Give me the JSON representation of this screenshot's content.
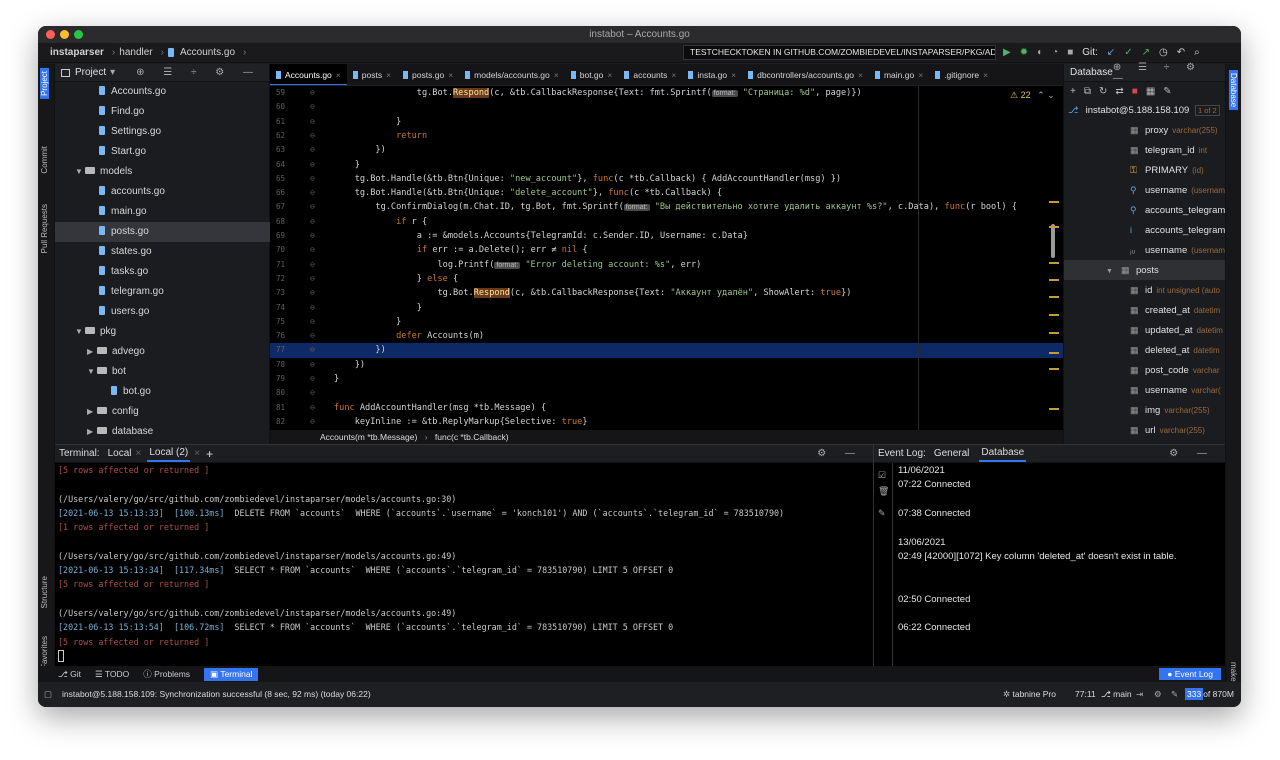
{
  "window": {
    "title": "instabot – Accounts.go"
  },
  "navbar": {
    "crumbs": [
      "instaparser",
      "handler",
      "Accounts.go"
    ],
    "run_config": "TESTCHECKTOKEN IN GITHUB.COM/ZOMBIEDEVEL/INSTAPARSER/PKG/ADVEGO",
    "git_label": "Git:"
  },
  "project": {
    "title": "Project",
    "items": [
      {
        "label": "Accounts.go",
        "type": "file",
        "indent": 3
      },
      {
        "label": "Find.go",
        "type": "file",
        "indent": 3
      },
      {
        "label": "Settings.go",
        "type": "file",
        "indent": 3
      },
      {
        "label": "Start.go",
        "type": "file",
        "indent": 3
      },
      {
        "label": "models",
        "type": "folder-open",
        "indent": 1
      },
      {
        "label": "accounts.go",
        "type": "file",
        "indent": 3
      },
      {
        "label": "main.go",
        "type": "file",
        "indent": 3
      },
      {
        "label": "posts.go",
        "type": "file",
        "indent": 3,
        "selected": true
      },
      {
        "label": "states.go",
        "type": "file",
        "indent": 3
      },
      {
        "label": "tasks.go",
        "type": "file",
        "indent": 3
      },
      {
        "label": "telegram.go",
        "type": "file",
        "indent": 3
      },
      {
        "label": "users.go",
        "type": "file",
        "indent": 3
      },
      {
        "label": "pkg",
        "type": "folder-open",
        "indent": 1
      },
      {
        "label": "advego",
        "type": "folder",
        "indent": 2
      },
      {
        "label": "bot",
        "type": "folder-open",
        "indent": 2
      },
      {
        "label": "bot.go",
        "type": "file",
        "indent": 4
      },
      {
        "label": "config",
        "type": "folder",
        "indent": 2
      },
      {
        "label": "database",
        "type": "folder",
        "indent": 2
      }
    ]
  },
  "editor": {
    "tabs": [
      {
        "label": "Accounts.go",
        "active": true
      },
      {
        "label": "posts"
      },
      {
        "label": "posts.go"
      },
      {
        "label": "models/accounts.go"
      },
      {
        "label": "bot.go"
      },
      {
        "label": "accounts"
      },
      {
        "label": "insta.go"
      },
      {
        "label": "dbcontrollers/accounts.go"
      },
      {
        "label": "main.go"
      },
      {
        "label": ".gitignore"
      }
    ],
    "warnings": "22",
    "current_line": "77",
    "lines": [
      {
        "n": "59",
        "code": "                tg.Bot.Respond(c, &tb.CallbackResponse{Text: fmt.Sprintf(format: \"Страница: %d\", page)})"
      },
      {
        "n": "60",
        "code": ""
      },
      {
        "n": "61",
        "code": "            }"
      },
      {
        "n": "62",
        "code": "            return"
      },
      {
        "n": "63",
        "code": "        })"
      },
      {
        "n": "64",
        "code": "    }"
      },
      {
        "n": "65",
        "code": "    tg.Bot.Handle(&tb.Btn{Unique: \"new_account\"}, func(c *tb.Callback) { AddAccountHandler(msg) })"
      },
      {
        "n": "66",
        "code": "    tg.Bot.Handle(&tb.Btn{Unique: \"delete_account\"}, func(c *tb.Callback) {"
      },
      {
        "n": "67",
        "code": "        tg.ConfirmDialog(m.Chat.ID, tg.Bot, fmt.Sprintf(format: \"Вы действительно хотите удалить аккаунт %s?\", c.Data), func(r bool) {"
      },
      {
        "n": "68",
        "code": "            if r {"
      },
      {
        "n": "69",
        "code": "                a := &models.Accounts{TelegramId: c.Sender.ID, Username: c.Data}"
      },
      {
        "n": "70",
        "code": "                if err := a.Delete(); err ≠ nil {"
      },
      {
        "n": "71",
        "code": "                    log.Printf(format: \"Error deleting account: %s\", err)"
      },
      {
        "n": "72",
        "code": "                } else {"
      },
      {
        "n": "73",
        "code": "                    tg.Bot.Respond(c, &tb.CallbackResponse{Text: \"Аккаунт удалён\", ShowAlert: true})"
      },
      {
        "n": "74",
        "code": "                }"
      },
      {
        "n": "75",
        "code": "            }"
      },
      {
        "n": "76",
        "code": "            defer Accounts(m)"
      },
      {
        "n": "77",
        "code": "        })"
      },
      {
        "n": "78",
        "code": "    })"
      },
      {
        "n": "79",
        "code": "}"
      },
      {
        "n": "80",
        "code": ""
      },
      {
        "n": "81",
        "code": "func AddAccountHandler(msg *tb.Message) {"
      },
      {
        "n": "82",
        "code": "    keyInline := &tb.ReplyMarkup{Selective: true}"
      }
    ],
    "footer_crumbs": [
      "Accounts(m *tb.Message)",
      "func(c *tb.Callback)"
    ]
  },
  "database": {
    "title": "Database",
    "connection": "instabot@5.188.158.109",
    "connection_badge": "1 of 2",
    "rows": [
      {
        "label": "proxy",
        "sub": "varchar(255)",
        "icon": "column"
      },
      {
        "label": "telegram_id",
        "sub": "int",
        "icon": "column-key"
      },
      {
        "label": "PRIMARY",
        "sub": "(id)",
        "icon": "key"
      },
      {
        "label": "username",
        "sub": "(usernam",
        "icon": "index"
      },
      {
        "label": "accounts_telegram",
        "sub": "",
        "icon": "fk"
      },
      {
        "label": "accounts_telegram",
        "sub": "",
        "icon": "index-i"
      },
      {
        "label": "username",
        "sub": "(usernam",
        "icon": "index-u"
      },
      {
        "label": "posts",
        "sub": "",
        "icon": "table",
        "selected": true
      },
      {
        "label": "id",
        "sub": "int unsigned (auto",
        "icon": "column-key"
      },
      {
        "label": "created_at",
        "sub": "datetim",
        "icon": "column"
      },
      {
        "label": "updated_at",
        "sub": "datetim",
        "icon": "column"
      },
      {
        "label": "deleted_at",
        "sub": "datetim",
        "icon": "column"
      },
      {
        "label": "post_code",
        "sub": "varchar",
        "icon": "column"
      },
      {
        "label": "username",
        "sub": "varchar(",
        "icon": "column"
      },
      {
        "label": "img",
        "sub": "varchar(255)",
        "icon": "column"
      },
      {
        "label": "url",
        "sub": "varchar(255)",
        "icon": "column"
      }
    ]
  },
  "terminal": {
    "label": "Terminal:",
    "tabs": [
      "Local",
      "Local (2)"
    ],
    "lines": [
      {
        "kind": "red",
        "text": "[5 rows affected or returned ]"
      },
      {
        "kind": "blank",
        "text": ""
      },
      {
        "kind": "path",
        "text": "(/Users/valery/go/src/github.com/zombiedevel/instaparser/models/accounts.go:30)"
      },
      {
        "kind": "sql",
        "ts": "[2021-06-13 15:13:33]",
        "ms": "[100.13ms]",
        "text": "DELETE FROM `accounts`  WHERE (`accounts`.`username` = 'konch101') AND (`accounts`.`telegram_id` = 783510790)"
      },
      {
        "kind": "red",
        "text": "[1 rows affected or returned ]"
      },
      {
        "kind": "blank",
        "text": ""
      },
      {
        "kind": "path",
        "text": "(/Users/valery/go/src/github.com/zombiedevel/instaparser/models/accounts.go:49)"
      },
      {
        "kind": "sql",
        "ts": "[2021-06-13 15:13:34]",
        "ms": "[117.34ms]",
        "text": "SELECT * FROM `accounts`  WHERE (`accounts`.`telegram_id` = 783510790) LIMIT 5 OFFSET 0"
      },
      {
        "kind": "red",
        "text": "[5 rows affected or returned ]"
      },
      {
        "kind": "blank",
        "text": ""
      },
      {
        "kind": "path",
        "text": "(/Users/valery/go/src/github.com/zombiedevel/instaparser/models/accounts.go:49)"
      },
      {
        "kind": "sql",
        "ts": "[2021-06-13 15:13:54]",
        "ms": "[106.72ms]",
        "text": "SELECT * FROM `accounts`  WHERE (`accounts`.`telegram_id` = 783510790) LIMIT 5 OFFSET 0"
      },
      {
        "kind": "red",
        "text": "[5 rows affected or returned ]"
      }
    ]
  },
  "event_log": {
    "label": "Event Log:",
    "tabs": [
      "General",
      "Database"
    ],
    "entries": [
      {
        "text": "11/06/2021"
      },
      {
        "text": "07:22   Connected"
      },
      {
        "text": ""
      },
      {
        "text": "07:38   Connected"
      },
      {
        "text": ""
      },
      {
        "text": "13/06/2021"
      },
      {
        "text": "02:49   [42000][1072] Key column 'deleted_at' doesn't exist in table."
      },
      {
        "text": ""
      },
      {
        "text": ""
      },
      {
        "text": "02:50   Connected"
      },
      {
        "text": ""
      },
      {
        "text": "06:22   Connected"
      }
    ]
  },
  "tool_tabs": [
    "Git",
    "TODO",
    "Problems",
    "Terminal"
  ],
  "event_log_button": "Event Log",
  "status": {
    "message": "instabot@5.188.158.109: Synchronization successful (8 sec, 92 ms) (today 06:22)",
    "tabnine": "tabnine Pro",
    "position": "77:11",
    "branch": "main",
    "memory_used": "333",
    "memory_total": "of 870M"
  },
  "left_vtabs": [
    "Project",
    "Commit",
    "Pull Requests",
    "Structure",
    "Favorites"
  ],
  "right_vtabs": [
    "Database",
    "make"
  ],
  "colors": {
    "accent": "#3574f0",
    "caret_line": "#0e2a66",
    "string": "#9ec58a",
    "keyword": "#cc7832",
    "error": "#b34d4d"
  }
}
